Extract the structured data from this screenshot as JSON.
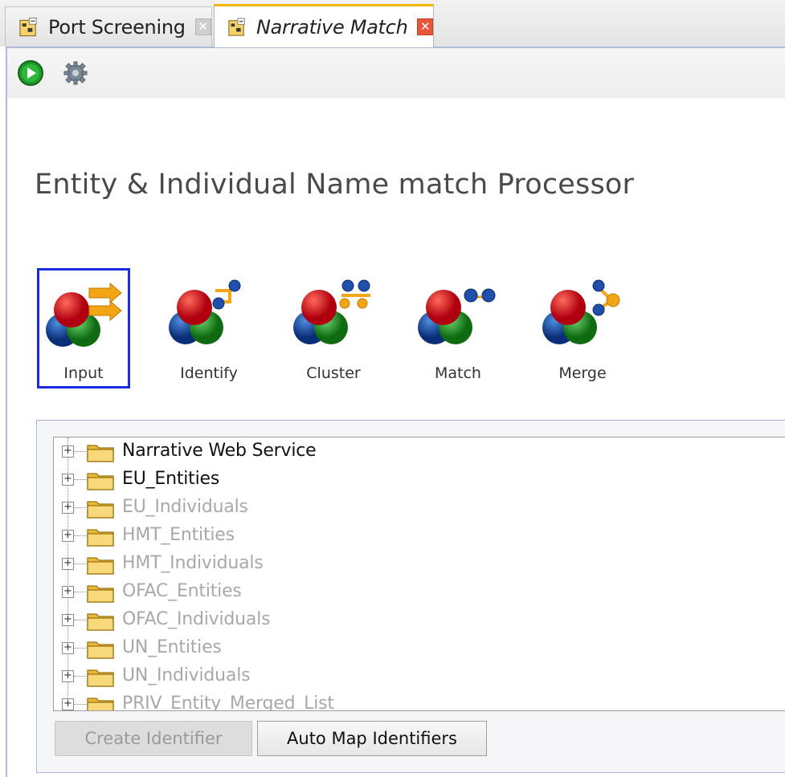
{
  "tabs": [
    {
      "label": "Port Screening",
      "active": false,
      "icon": "processor-icon",
      "close": "close-icon"
    },
    {
      "label": "Narrative Match",
      "active": true,
      "icon": "processor-icon",
      "close": "close-icon"
    }
  ],
  "toolbar": {
    "run_icon": "run-icon",
    "settings_icon": "gear-icon"
  },
  "title": "Entity & Individual Name match Processor",
  "steps": [
    {
      "label": "Input",
      "selected": true
    },
    {
      "label": "Identify",
      "selected": false
    },
    {
      "label": "Cluster",
      "selected": false
    },
    {
      "label": "Match",
      "selected": false
    },
    {
      "label": "Merge",
      "selected": false
    }
  ],
  "tree": [
    {
      "label": "Narrative Web Service",
      "enabled": true
    },
    {
      "label": "EU_Entities",
      "enabled": true
    },
    {
      "label": "EU_Individuals",
      "enabled": false
    },
    {
      "label": "HMT_Entities",
      "enabled": false
    },
    {
      "label": "HMT_Individuals",
      "enabled": false
    },
    {
      "label": "OFAC_Entities",
      "enabled": false
    },
    {
      "label": "OFAC_Individuals",
      "enabled": false
    },
    {
      "label": "UN_Entities",
      "enabled": false
    },
    {
      "label": "UN_Individuals",
      "enabled": false
    },
    {
      "label": "PRIV_Entity_Merged_List",
      "enabled": false
    }
  ],
  "buttons": {
    "create_identifier": "Create Identifier",
    "auto_map_identifiers": "Auto Map Identifiers"
  },
  "colors": {
    "selection_border": "#1a2be0",
    "tab_active_accent": "#f5b400",
    "close_active": "#e8563c",
    "panel_border": "#aebadb"
  }
}
